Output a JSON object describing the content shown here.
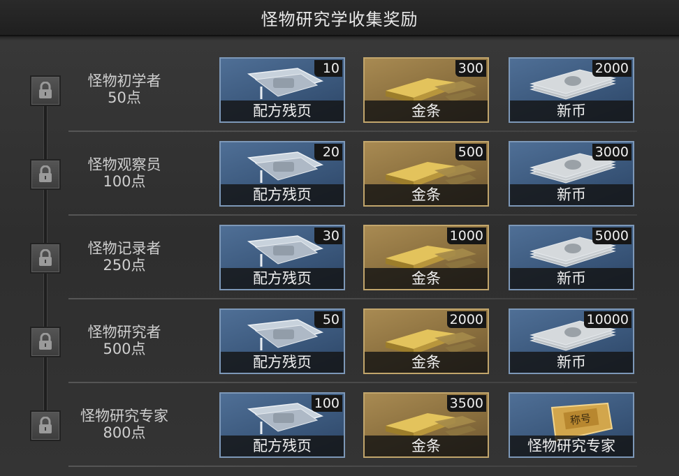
{
  "header": {
    "title": "怪物研究学收集奖励"
  },
  "tiers": [
    {
      "name": "怪物初学者",
      "points": "50点",
      "rewards": [
        {
          "type": "recipe",
          "qty": "10",
          "label": "配方残页"
        },
        {
          "type": "gold",
          "qty": "300",
          "label": "金条"
        },
        {
          "type": "money",
          "qty": "2000",
          "label": "新币"
        }
      ]
    },
    {
      "name": "怪物观察员",
      "points": "100点",
      "rewards": [
        {
          "type": "recipe",
          "qty": "20",
          "label": "配方残页"
        },
        {
          "type": "gold",
          "qty": "500",
          "label": "金条"
        },
        {
          "type": "money",
          "qty": "3000",
          "label": "新币"
        }
      ]
    },
    {
      "name": "怪物记录者",
      "points": "250点",
      "rewards": [
        {
          "type": "recipe",
          "qty": "30",
          "label": "配方残页"
        },
        {
          "type": "gold",
          "qty": "1000",
          "label": "金条"
        },
        {
          "type": "money",
          "qty": "5000",
          "label": "新币"
        }
      ]
    },
    {
      "name": "怪物研究者",
      "points": "500点",
      "rewards": [
        {
          "type": "recipe",
          "qty": "50",
          "label": "配方残页"
        },
        {
          "type": "gold",
          "qty": "2000",
          "label": "金条"
        },
        {
          "type": "money",
          "qty": "10000",
          "label": "新币"
        }
      ]
    },
    {
      "name": "怪物研究专家",
      "points": "800点",
      "rewards": [
        {
          "type": "recipe",
          "qty": "100",
          "label": "配方残页"
        },
        {
          "type": "gold",
          "qty": "3500",
          "label": "金条"
        },
        {
          "type": "title",
          "qty": "",
          "label": "怪物研究专家",
          "ticket_text": "称号"
        }
      ]
    }
  ],
  "colors": {
    "card_blue": "#3b587c",
    "card_gold": "#8a6f3e",
    "qty_badge": "#161616"
  },
  "icons": {
    "lock": "padlock-icon",
    "recipe": "recipe-page-icon",
    "gold": "gold-bar-icon",
    "money": "banknote-stack-icon",
    "title": "title-ticket-icon"
  }
}
